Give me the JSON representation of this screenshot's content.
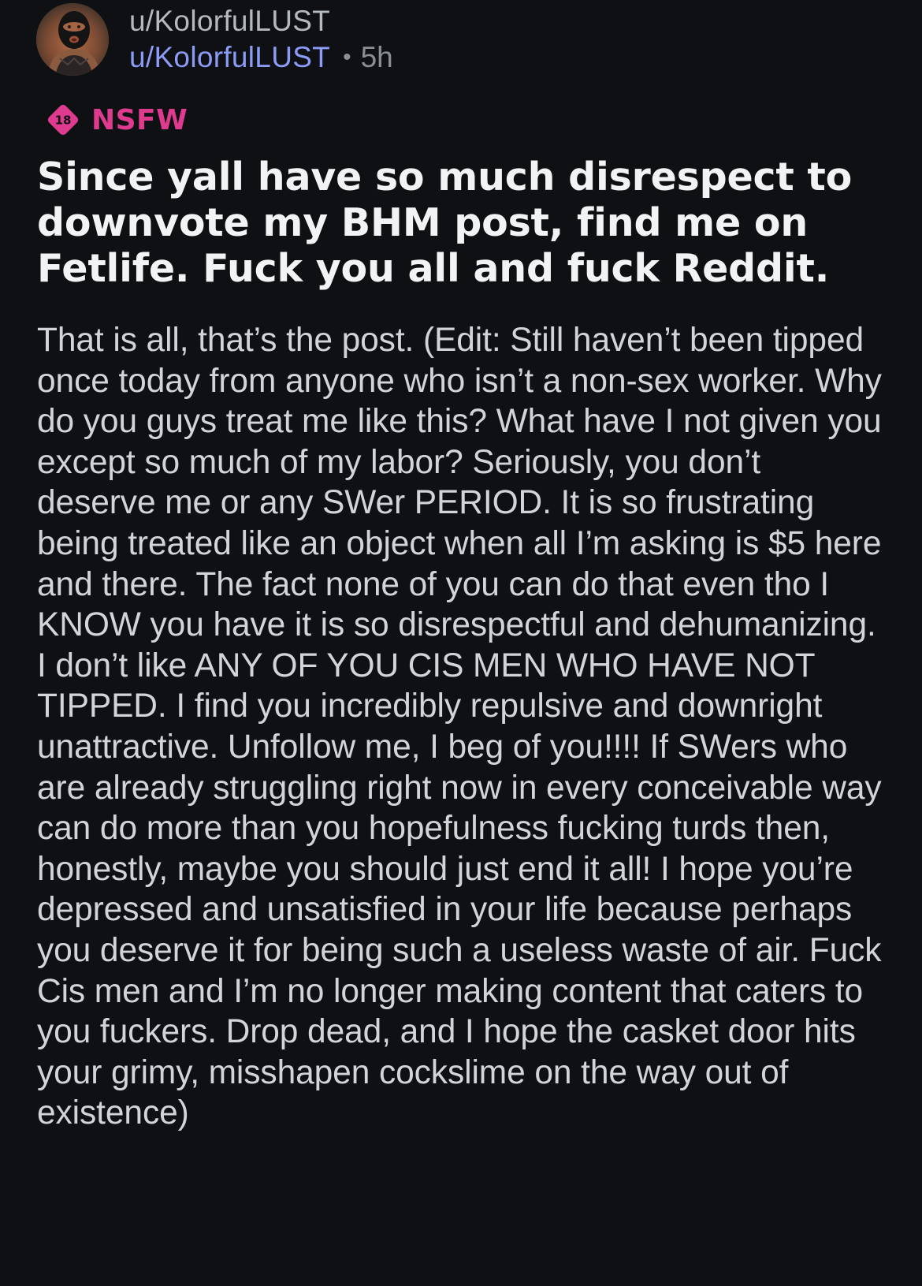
{
  "post": {
    "author_display": "u/KolorfulLUST",
    "author_username": "u/KolorfulLUST",
    "separator": "•",
    "age": "5h",
    "nsfw": {
      "badge_number": "18",
      "label": "NSFW",
      "icon": "nsfw-18-diamond-icon",
      "color": "#de3b8f"
    },
    "avatar_icon": "user-avatar",
    "title": "Since yall have so much disrespect to downvote my BHM post, find me on Fetlife. Fuck you all and fuck Reddit.",
    "body": "That is all, that’s the post. (Edit: Still haven’t been tipped once today from anyone who isn’t a non-sex worker. Why do you guys treat me like this? What have I not given you except so much of my labor? Seriously, you don’t deserve me or any SWer PERIOD. It is so frustrating being treated like an object when all I’m asking is $5 here and there. The fact none of you can do that even tho I KNOW you have it is so disrespectful and dehumanizing. I don’t like ANY OF YOU CIS MEN WHO HAVE NOT TIPPED. I find you incredibly repulsive and downright unattractive. Unfollow me, I beg of you!!!! If SWers who are already struggling right now in every conceivable way can do more than you hopefulness fucking turds then, honestly, maybe you should just end it all! I hope you’re depressed and unsatisfied in your life because perhaps you deserve it for being such a useless waste of air. Fuck Cis men and I’m no longer making content that caters to you fuckers. Drop dead, and I hope the casket door hits your grimy, misshapen cockslime on the way out of existence)"
  },
  "colors": {
    "background": "#0e1013",
    "title": "#f2f3f4",
    "body": "#d2d5d8",
    "username_link": "#8c9bf5",
    "meta": "#8a8f95"
  }
}
